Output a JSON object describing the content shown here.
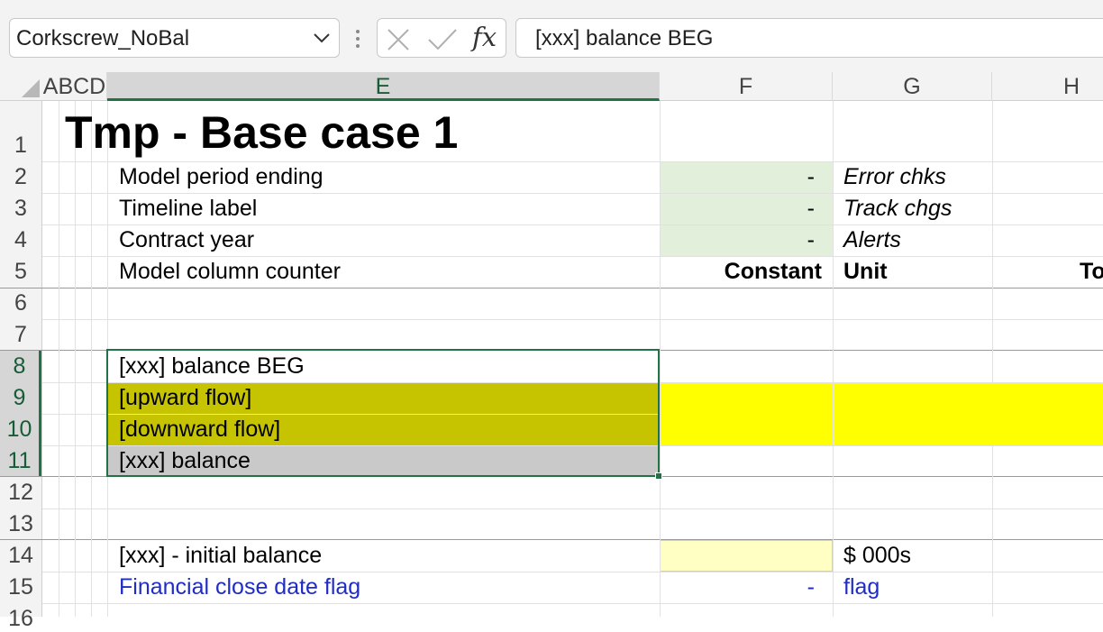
{
  "formula_bar": {
    "name_box": "Corkscrew_NoBal",
    "fx_label": "fx",
    "formula": "[xxx] balance BEG"
  },
  "columns": {
    "abcd": "ABCD",
    "e": "E",
    "f": "F",
    "g": "G",
    "h": "H"
  },
  "rows": [
    "1",
    "2",
    "3",
    "4",
    "5",
    "6",
    "7",
    "8",
    "9",
    "10",
    "11",
    "12",
    "13",
    "14",
    "15",
    "16"
  ],
  "sheet": {
    "title": "Tmp - Base case 1",
    "r2": {
      "label": "Model period ending",
      "f": "-",
      "g": "Error chks"
    },
    "r3": {
      "label": "Timeline label",
      "f": "-",
      "g": "Track chgs"
    },
    "r4": {
      "label": "Contract year",
      "f": "-",
      "g": "Alerts"
    },
    "r5": {
      "label": "Model column counter",
      "f": "Constant",
      "g": "Unit",
      "h": "To"
    },
    "r8": {
      "label": "[xxx] balance BEG"
    },
    "r9": {
      "label": "[upward flow]"
    },
    "r10": {
      "label": "[downward flow]"
    },
    "r11": {
      "label": "[xxx] balance"
    },
    "r14": {
      "label": "[xxx] - initial balance",
      "g": "$ 000s"
    },
    "r15": {
      "label": "Financial close date flag",
      "f": "-",
      "g": "flag"
    }
  },
  "colors": {
    "input_green": "#e2efda",
    "flow_olive": "#c6c300",
    "flow_yellow": "#ffff00",
    "balance_grey": "#c9c9c9",
    "input_lightyellow": "#ffffc4",
    "selection": "#217346",
    "link_blue": "#1f2cc6"
  },
  "icons": [
    "chevron-down-icon",
    "more-vertical-icon",
    "cancel-x-icon",
    "enter-check-icon",
    "function-fx-icon"
  ]
}
